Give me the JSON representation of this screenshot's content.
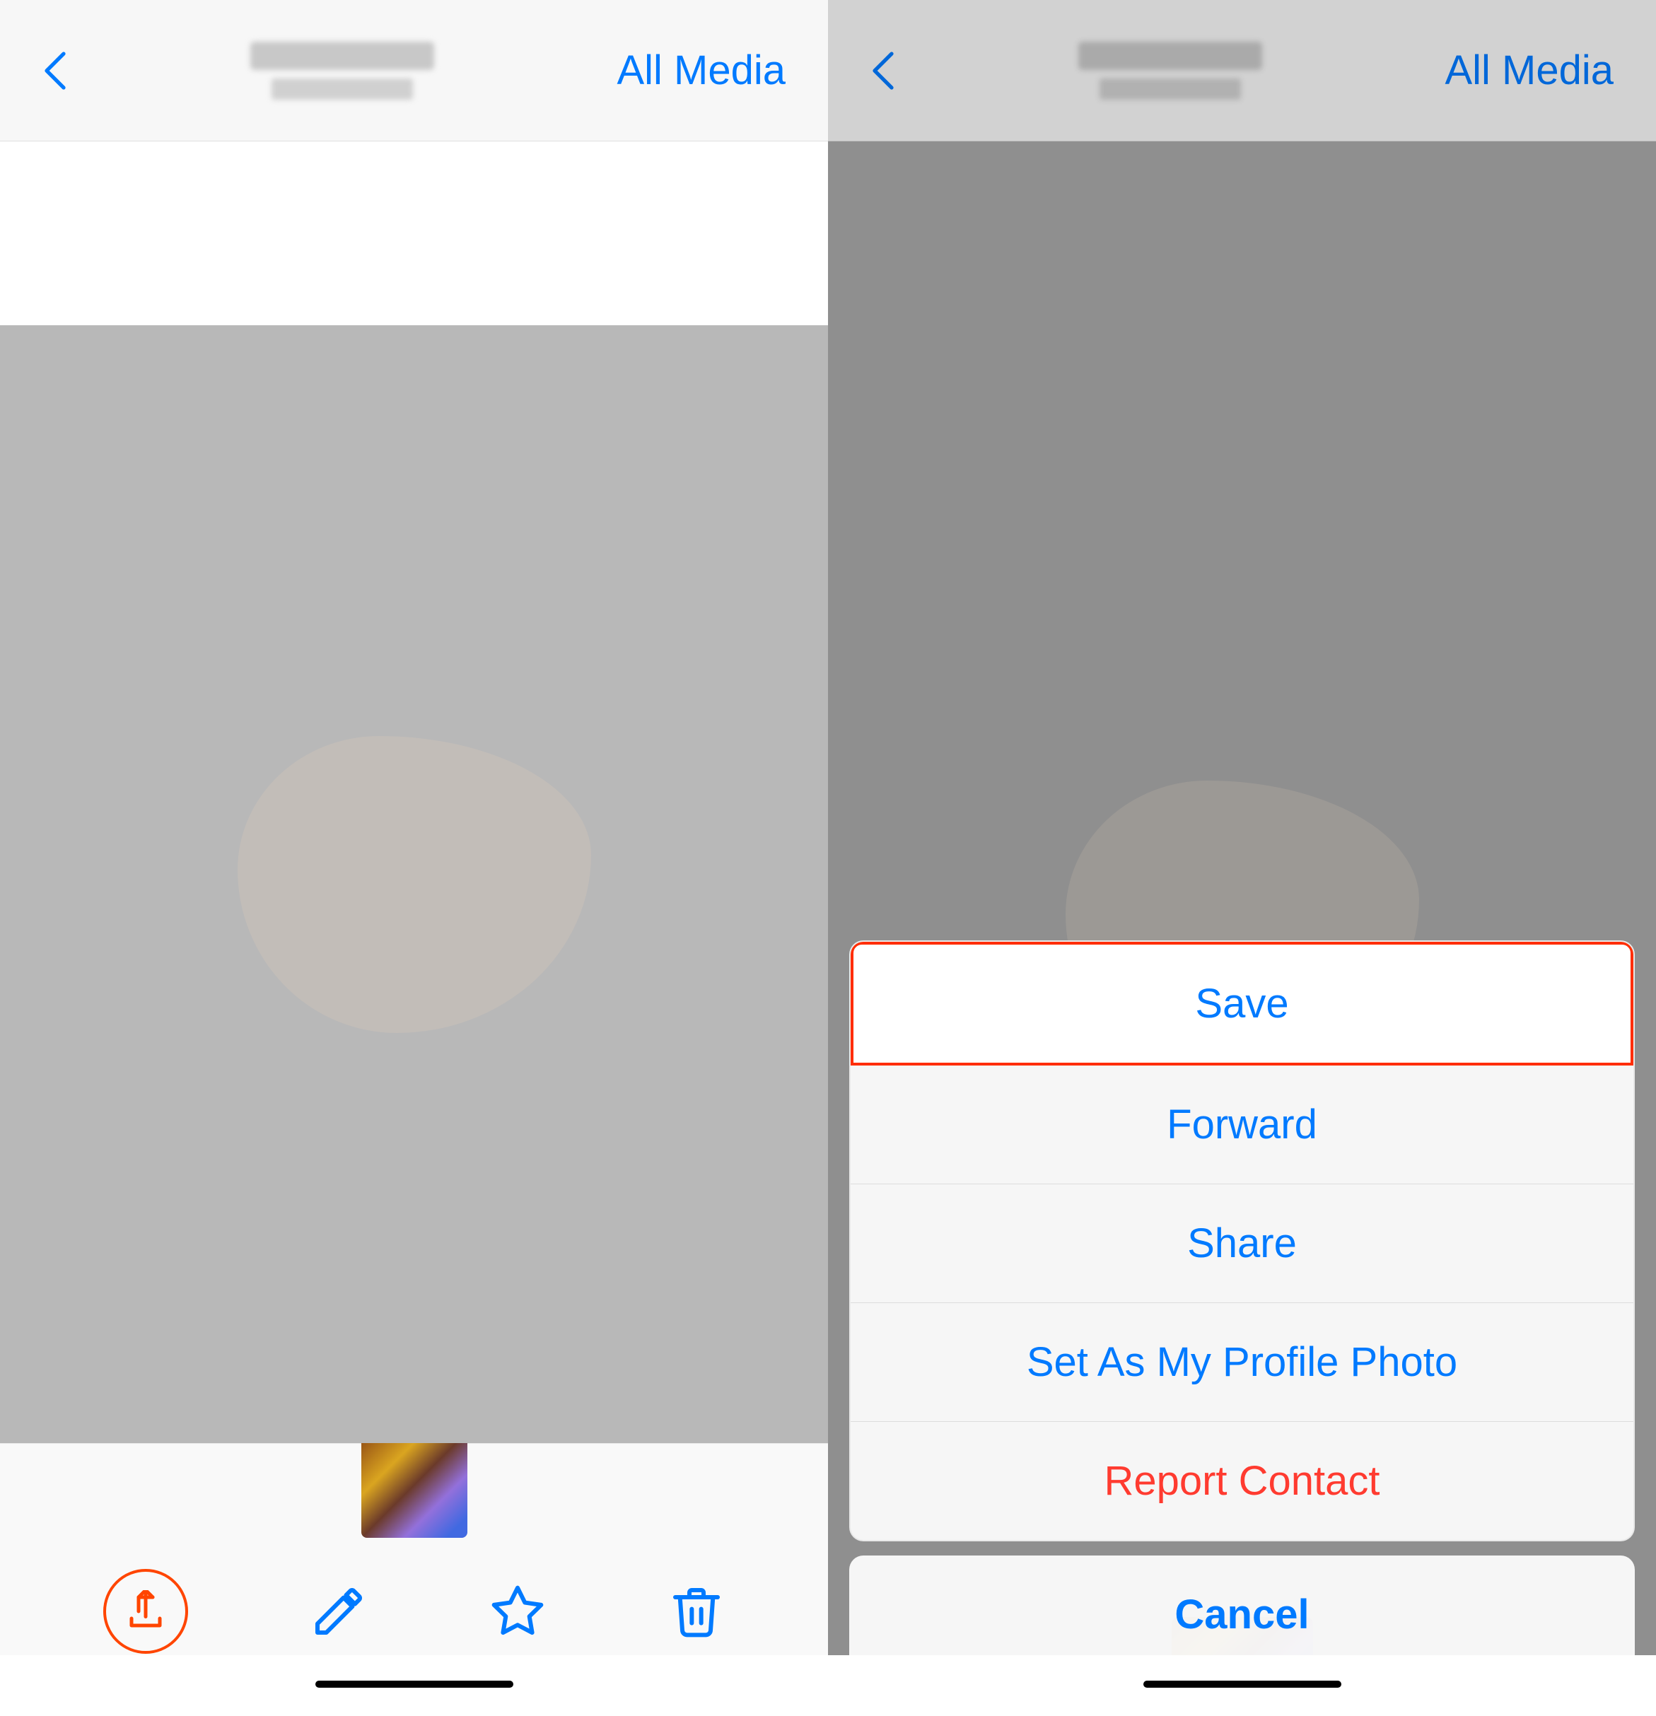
{
  "left": {
    "nav": {
      "back_label": "‹",
      "all_media_label": "All Media"
    },
    "toolbar": {
      "share_button_label": "share",
      "draw_button_label": "draw",
      "star_button_label": "star",
      "trash_button_label": "trash"
    },
    "home_indicator": true
  },
  "right": {
    "nav": {
      "back_label": "‹",
      "all_media_label": "All Media"
    },
    "action_sheet": {
      "items": [
        {
          "label": "Save",
          "type": "normal",
          "highlighted": true
        },
        {
          "label": "Forward",
          "type": "normal",
          "highlighted": false
        },
        {
          "label": "Share",
          "type": "normal",
          "highlighted": false
        },
        {
          "label": "Set As My Profile Photo",
          "type": "normal",
          "highlighted": false
        },
        {
          "label": "Report Contact",
          "type": "destructive",
          "highlighted": false
        }
      ],
      "cancel_label": "Cancel"
    },
    "home_indicator": true
  }
}
